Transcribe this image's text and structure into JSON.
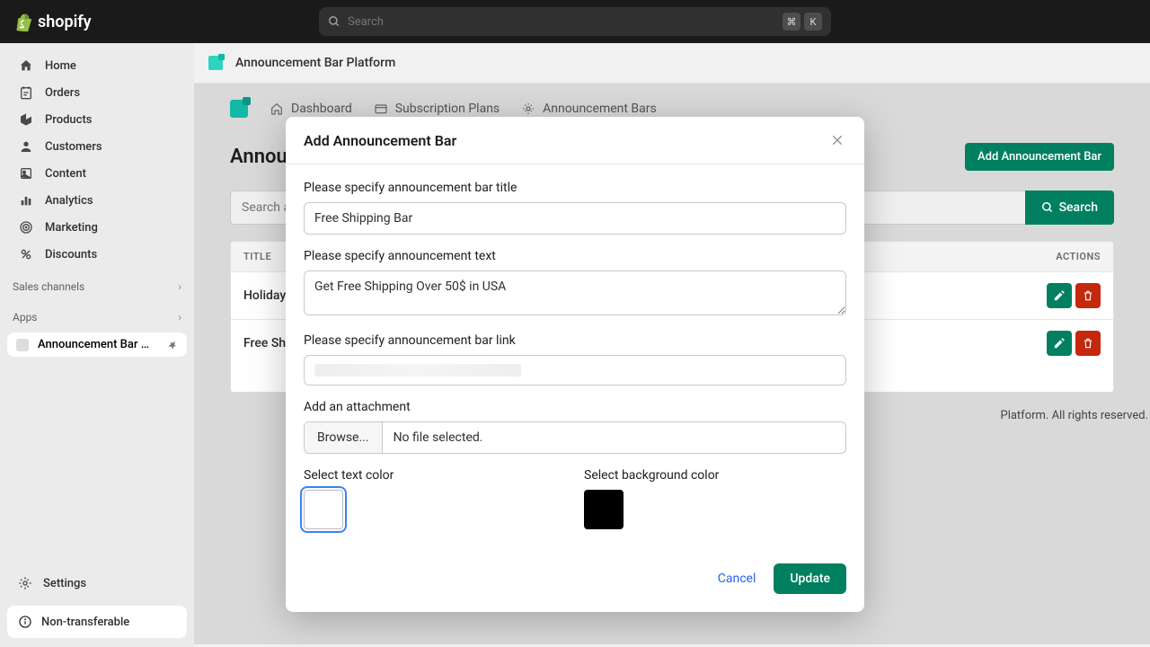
{
  "brand": "shopify",
  "search": {
    "placeholder": "Search",
    "kbd1": "⌘",
    "kbd2": "K"
  },
  "nav": {
    "home": "Home",
    "orders": "Orders",
    "products": "Products",
    "customers": "Customers",
    "content": "Content",
    "analytics": "Analytics",
    "marketing": "Marketing",
    "discounts": "Discounts"
  },
  "sections": {
    "sales": "Sales channels",
    "apps": "Apps"
  },
  "app_item": "Announcement Bar Pl...",
  "settings": "Settings",
  "nontransferable": "Non-transferable",
  "app_header": "Announcement Bar Platform",
  "app_nav": {
    "dashboard": "Dashboard",
    "subs": "Subscription Plans",
    "bars": "Announcement Bars"
  },
  "page": {
    "title": "Announcement Bars",
    "add_btn": "Add Announcement Bar",
    "search_placeholder": "Search announcement bar",
    "search_btn": "Search"
  },
  "table": {
    "col_title": "TITLE",
    "col_actions": "ACTIONS",
    "rows": [
      {
        "title": "Holiday Bar"
      },
      {
        "title": "Free Shipping Bar"
      }
    ]
  },
  "footer_copy": "Platform. All rights reserved.",
  "modal": {
    "title": "Add Announcement Bar",
    "label_title": "Please specify announcement bar title",
    "value_title": "Free Shipping Bar",
    "label_text": "Please specify announcement text",
    "value_text": "Get Free Shipping Over 50$ in USA",
    "label_link": "Please specify announcement bar link",
    "label_attach": "Add an attachment",
    "browse": "Browse...",
    "no_file": "No file selected.",
    "label_textcolor": "Select text color",
    "label_bgcolor": "Select background color",
    "text_color": "#ffffff",
    "bg_color": "#000000",
    "cancel": "Cancel",
    "update": "Update"
  }
}
